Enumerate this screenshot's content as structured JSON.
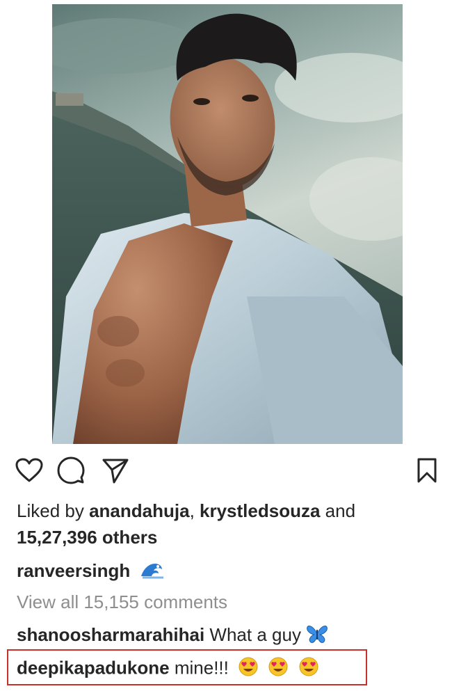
{
  "post": {
    "photo": {
      "description_icon": "photo-icon",
      "colors": {
        "sky_top": "#6f8a84",
        "sky_light": "#c9d4cc",
        "sea": "#3e5650",
        "shirt": "#bfd0d8",
        "skin": "#b07a5e",
        "hair": "#1c1a1a"
      }
    },
    "actions": {
      "like_icon": "heart-icon",
      "comment_icon": "comment-icon",
      "share_icon": "share-icon",
      "save_icon": "bookmark-icon"
    },
    "likes": {
      "prefix": "Liked by ",
      "user1": "anandahuja",
      "separator": ", ",
      "user2": "krystledsouza",
      "connector": " and",
      "count": "15,27,396 others"
    },
    "caption": {
      "username": "ranveersingh",
      "emoji": "water-wave-emoji"
    },
    "view_all": "View all 15,155 comments",
    "comments": [
      {
        "username": "shanoosharmarahihai",
        "text": " What a guy",
        "emoji": "butterfly-emoji"
      },
      {
        "username": "deepikapadukone",
        "text": " mine!!!",
        "emoji": "heart-eyes-emoji",
        "emoji_count": 3,
        "highlight_color": "#c9302c"
      }
    ]
  }
}
